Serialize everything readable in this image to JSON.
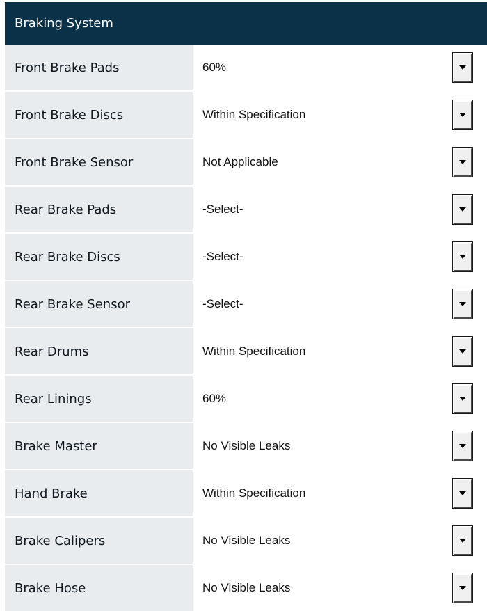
{
  "header": {
    "title": "Braking System"
  },
  "rows": [
    {
      "label": "Front Brake Pads",
      "value": "60%"
    },
    {
      "label": "Front Brake Discs",
      "value": "Within Specification"
    },
    {
      "label": "Front Brake Sensor",
      "value": "Not Applicable"
    },
    {
      "label": "Rear Brake Pads",
      "value": "-Select-"
    },
    {
      "label": "Rear Brake Discs",
      "value": "-Select-"
    },
    {
      "label": "Rear Brake Sensor",
      "value": "-Select-"
    },
    {
      "label": "Rear Drums",
      "value": "Within Specification"
    },
    {
      "label": "Rear Linings",
      "value": "60%"
    },
    {
      "label": "Brake Master",
      "value": "No Visible Leaks"
    },
    {
      "label": "Hand Brake",
      "value": "Within Specification"
    },
    {
      "label": "Brake Calipers",
      "value": "No Visible Leaks"
    },
    {
      "label": "Brake Hose",
      "value": "No Visible Leaks"
    }
  ],
  "icons": {
    "dropdown": "chevron-down-icon"
  },
  "colors": {
    "header_bg": "#0b3149",
    "header_text": "#ffffff",
    "label_bg": "#e9ecef"
  }
}
